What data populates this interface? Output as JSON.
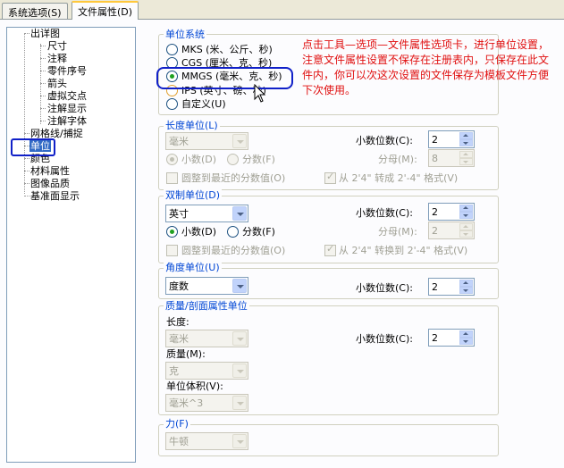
{
  "tabs": [
    "系统选项(S)",
    "文件属性(D)"
  ],
  "tree": {
    "items": [
      {
        "label": "出详图"
      },
      {
        "label": "尺寸"
      },
      {
        "label": "注释"
      },
      {
        "label": "零件序号"
      },
      {
        "label": "箭头"
      },
      {
        "label": "虚拟交点"
      },
      {
        "label": "注解显示"
      },
      {
        "label": "注解字体"
      },
      {
        "label": "网格线/捕捉"
      },
      {
        "label": "单位"
      },
      {
        "label": "颜色"
      },
      {
        "label": "材料属性"
      },
      {
        "label": "图像品质"
      },
      {
        "label": "基准面显示"
      }
    ],
    "selected": "单位"
  },
  "unit_system": {
    "title": "单位系统",
    "options": [
      {
        "label": "MKS  (米、公斤、秒)",
        "selected": false
      },
      {
        "label": "CGS  (厘米、克、秒)",
        "selected": false
      },
      {
        "label": "MMGS (毫米、克、秒)",
        "selected": true
      },
      {
        "label": "IPS  (英寸、磅、秒)",
        "selected": false
      },
      {
        "label": "自定义(U)",
        "selected": false
      }
    ]
  },
  "annotation_text": "点击工具—选项—文件属性选项卡，进行单位设置，注意文件属性设置不保存在注册表内，只保存在此文件内，你可以次这次设置的文件保存为模板文件方便下次使用。",
  "length_unit": {
    "title": "长度单位(L)",
    "unit": "毫米",
    "decimal_label": "小数位数(C):",
    "decimal_value": "2",
    "radio_decimal": "小数(D)",
    "radio_fraction": "分数(F)",
    "denominator_label": "分母(M):",
    "denominator_value": "8",
    "round_label": "圆整到最近的分数值(O)",
    "convert_label": "从 2'4\" 转成 2'-4\" 格式(V)"
  },
  "dual_unit": {
    "title": "双制单位(D)",
    "unit": "英寸",
    "decimal_label": "小数位数(C):",
    "decimal_value": "2",
    "radio_decimal": "小数(D)",
    "radio_fraction": "分数(F)",
    "denominator_label": "分母(M):",
    "denominator_value": "2",
    "round_label": "圆整到最近的分数值(O)",
    "convert_label": "从 2'4\" 转换到 2'-4\" 格式(V)"
  },
  "angle_unit": {
    "title": "角度单位(U)",
    "unit": "度数",
    "decimal_label": "小数位数(C):",
    "decimal_value": "2"
  },
  "mass_unit": {
    "title": "质量/剖面属性单位",
    "length_label": "长度:",
    "length_value": "毫米",
    "mass_label": "质量(M):",
    "mass_value": "克",
    "volume_label": "单位体积(V):",
    "volume_value": "毫米^3",
    "decimal_label": "小数位数(C):",
    "decimal_value": "2"
  },
  "force_unit": {
    "title": "力(F)",
    "unit": "牛顿"
  },
  "colors": {
    "group_title": "#0046d5",
    "annotation": "#e01010",
    "highlight": "#1020c8",
    "selection": "#316ac5"
  }
}
